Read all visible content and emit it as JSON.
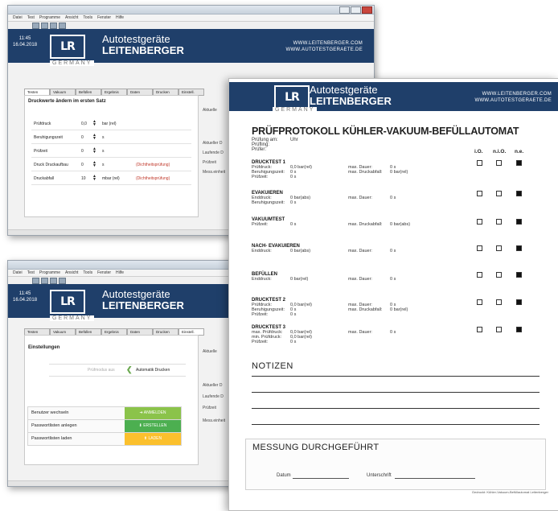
{
  "brand": {
    "line1": "Autotestgeräte",
    "line2": "LEITENBERGER",
    "logo": "LR",
    "sub": "GERMANY",
    "url1": "WWW.LEITENBERGER.COM",
    "url2": "WWW.AUTOTESTGERAETE.DE",
    "color_header": "#1f3f6a"
  },
  "window1": {
    "time": "11:45",
    "date": "16.04.2018",
    "menu": [
      "Datei",
      "Test",
      "Programme",
      "Ansicht",
      "Tools",
      "Fenster",
      "Hilfe"
    ],
    "tabs": [
      "Testen",
      "Vakuum",
      "Befüllen",
      "Ergebnis",
      "Daten",
      "Drucken",
      "Einstell."
    ],
    "panel_title": "Druckwerte ändern im ersten Satz",
    "rows": [
      {
        "label": "Prüfdruck",
        "value": "0,0",
        "unit": "bar (rel)",
        "note": ""
      },
      {
        "label": "Beruhigungszeit",
        "value": "0",
        "unit": "s",
        "note": ""
      },
      {
        "label": "Prüfzeit",
        "value": "0",
        "unit": "s",
        "note": ""
      },
      {
        "label": "Druck Druckaufbau",
        "value": "0",
        "unit": "s",
        "note": "(Dichtheitsprüfung)"
      },
      {
        "label": "Druckabfall",
        "value": "10",
        "unit": "mbar (rel)",
        "note": "(Dichtheitsprüfung)"
      }
    ],
    "side": [
      "Aktuelle",
      "Aktueller D",
      "Laufende D",
      "Prüfzeit",
      "Mess.einheit"
    ]
  },
  "window2": {
    "time": "11:45",
    "date": "16.04.2018",
    "menu": [
      "Datei",
      "Test",
      "Programme",
      "Ansicht",
      "Tools",
      "Fenster",
      "Hilfe"
    ],
    "tabs": [
      "Testen",
      "Vakuum",
      "Befüllen",
      "Ergebnis",
      "Daten",
      "Drucken",
      "Einstell."
    ],
    "panel_title": "Einstellungen",
    "toggle_left": "Prüfmodus aus",
    "toggle_right": "Automatik Drucken",
    "rows": [
      {
        "label": "Benutzer wechseln",
        "button": "ANMELDEN",
        "color": "#8bc34a"
      },
      {
        "label": "Passwortlisten anlegen",
        "button": "ERSTELLEN",
        "color": "#4caf50"
      },
      {
        "label": "Passwortlisten laden",
        "button": "LADEN",
        "color": "#fbc02d"
      }
    ],
    "side": [
      "Aktuelle",
      "Aktueller D",
      "Laufende D",
      "Prüfzeit",
      "Mess.einheit"
    ]
  },
  "protocol": {
    "title": "PRÜFPROTOKOLL KÜHLER-VAKUUM-BEFÜLLAUTOMAT",
    "meta": [
      {
        "label": "Prüfung am:",
        "value": "Uhr"
      },
      {
        "label": "Prüfling:",
        "value": ""
      },
      {
        "label": "Prüfer:",
        "value": ""
      }
    ],
    "columns": [
      "i.O.",
      "n.i.O.",
      "n.e."
    ],
    "sections": [
      {
        "title": "DRUCKTEST 1",
        "rows": [
          [
            "Prüfdruck:",
            "0,0 bar(rel)",
            "max. Dauer:",
            "0 s"
          ],
          [
            "Beruhigungszeit:",
            "0 s",
            "max. Druckabfall:",
            "0 bar(rel)"
          ],
          [
            "Prüfzeit:",
            "0 s",
            "",
            ""
          ]
        ]
      },
      {
        "title": "EVAKUIEREN",
        "rows": [
          [
            "Enddruck:",
            "0 bar(abs)",
            "max. Dauer:",
            "0 s"
          ],
          [
            "Beruhigungszeit:",
            "0 s",
            "",
            ""
          ]
        ]
      },
      {
        "title": "VAKUUMTEST",
        "rows": [
          [
            "Prüfzeit:",
            "0 s",
            "max. Druckabfall:",
            "0 bar(abs)"
          ]
        ]
      },
      {
        "title": "NACH- EVAKUIEREN",
        "rows": [
          [
            "Enddruck:",
            "0 bar(abs)",
            "max. Dauer:",
            "0 s"
          ]
        ]
      },
      {
        "title": "BEFÜLLEN",
        "rows": [
          [
            "Enddruck:",
            "0 bar(rel)",
            "max. Dauer:",
            "0 s"
          ]
        ]
      },
      {
        "title": "DRUCKTEST 2",
        "rows": [
          [
            "Prüfdruck:",
            "0,0 bar(rel)",
            "max. Dauer:",
            "0 s"
          ],
          [
            "Beruhigungszeit:",
            "0 s",
            "max. Druckabfall:",
            "0 bar(rel)"
          ],
          [
            "Prüfzeit:",
            "0 s",
            "",
            ""
          ]
        ]
      },
      {
        "title": "DRUCKTEST 3",
        "rows": [
          [
            "max. Prüfdruck:",
            "0,0 bar(rel)",
            "max. Dauer:",
            "0 s"
          ],
          [
            "min. Prüfdruck:",
            "0,0 bar(rel)",
            "",
            ""
          ],
          [
            "Prüfzeit:",
            "0 s",
            "",
            ""
          ]
        ]
      }
    ],
    "notes_title": "NOTIZEN",
    "measure_title": "MESSUNG DURCHGEFÜHRT",
    "date_label": "Datum",
    "sign_label": "Unterschrift",
    "footnote": "Gedruckt: Kühler-Vakuum-Befüllautomat Leitenberger"
  }
}
